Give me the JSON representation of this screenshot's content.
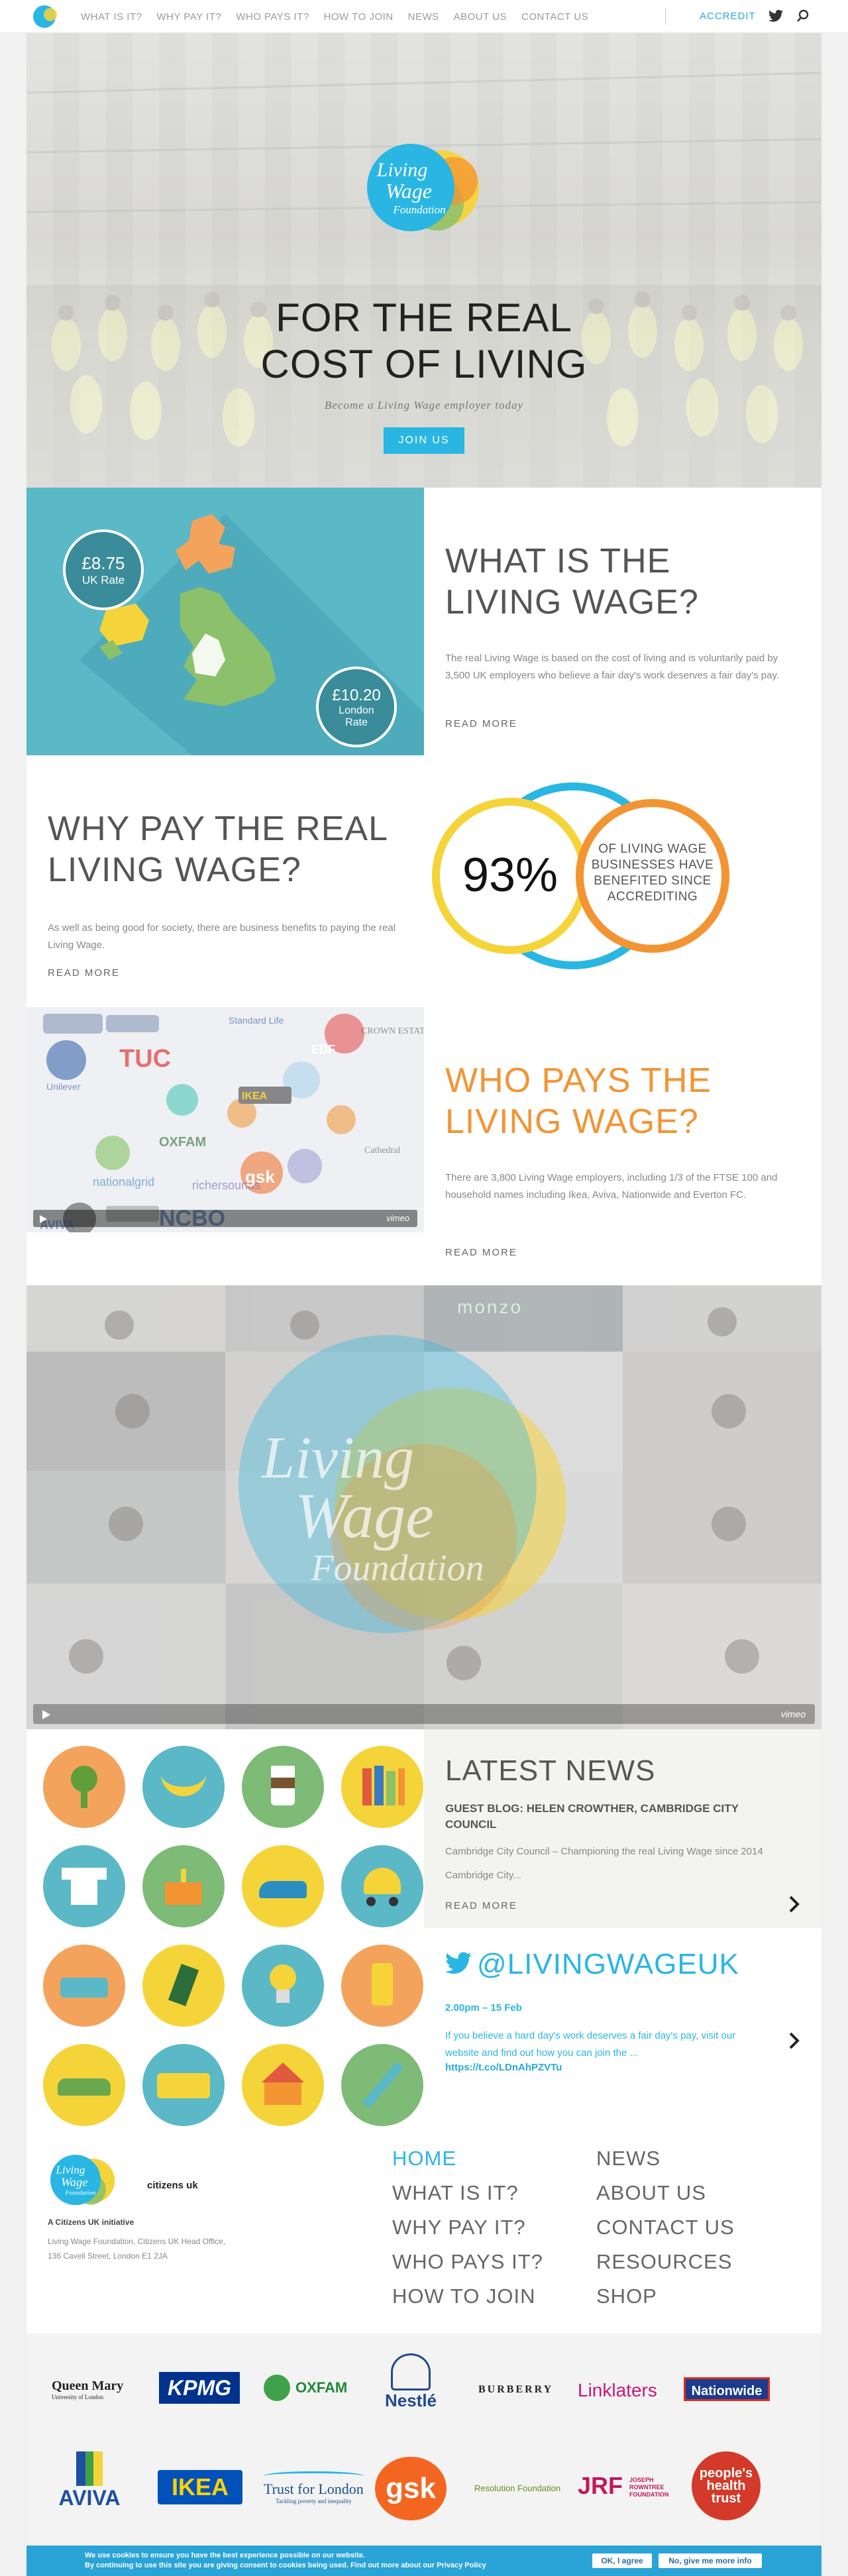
{
  "nav": {
    "items": [
      "WHAT IS IT?",
      "WHY PAY IT?",
      "WHO PAYS IT?",
      "HOW TO JOIN",
      "NEWS",
      "ABOUT US",
      "CONTACT US"
    ],
    "accredit": "ACCREDIT"
  },
  "hero": {
    "logo_line1": "Living",
    "logo_line2": "Wage",
    "logo_line3": "Foundation",
    "title_line1": "FOR THE REAL",
    "title_line2": "COST OF LIVING",
    "subtitle": "Become a Living Wage employer today",
    "button": "JOIN US"
  },
  "what": {
    "uk_rate_value": "£8.75",
    "uk_rate_label": "UK Rate",
    "london_rate_value": "£10.20",
    "london_rate_label1": "London",
    "london_rate_label2": "Rate",
    "title_line1": "WHAT IS THE",
    "title_line2": "LIVING WAGE?",
    "body": "The real Living Wage is based on the cost of living and is voluntarily paid by 3,500 UK employers who believe a fair day's work deserves a fair day's pay.",
    "read_more": "READ MORE"
  },
  "why": {
    "title_line1": "WHY PAY THE REAL",
    "title_line2": "LIVING WAGE?",
    "body": "As well as being good for society, there are business benefits to paying the real Living Wage.",
    "read_more": "READ MORE",
    "stat_value": "93%",
    "stat_line1": "OF LIVING WAGE",
    "stat_line2": "BUSINESSES HAVE",
    "stat_line3": "BENEFITED SINCE",
    "stat_line4": "ACCREDITING"
  },
  "who": {
    "title_line1": "WHO PAYS THE",
    "title_line2": "LIVING WAGE?",
    "body": "There are 3,800 Living Wage employers, including 1/3 of the FTSE 100 and household names including Ikea, Aviva, Nationwide and Everton FC.",
    "read_more": "READ MORE",
    "video_brand": "vimeo",
    "logo_labels": [
      "TUC",
      "OXFAM",
      "nationalgrid",
      "richersounds",
      "NCBO",
      "gsk",
      "Unilever",
      "Standard Life",
      "EDF",
      "IKEA",
      "CROWN ESTATE",
      "AVIVA",
      "Cathedral"
    ]
  },
  "video": {
    "logo_line1": "Living",
    "logo_line2": "Wage",
    "logo_line3": "Foundation",
    "brand": "vimeo",
    "sign_text": "monzo"
  },
  "news": {
    "heading": "LATEST NEWS",
    "post_title": "GUEST BLOG: HELEN CROWTHER, CAMBRIDGE CITY COUNCIL",
    "excerpt_line1": "Cambridge City Council – Championing the real Living Wage since 2014",
    "excerpt_line2": "Cambridge City...",
    "read_more": "READ MORE"
  },
  "twitter": {
    "handle": "@LIVINGWAGEUK",
    "time": "2.00pm – 15 Feb",
    "text": "If you believe a hard day's work deserves a fair day's pay, visit our website and find out how you can join the ...",
    "link": "https://t.co/LDnAhPZVTu"
  },
  "footer": {
    "logo_line1": "Living",
    "logo_line2": "Wage",
    "logo_line3": "Foundation",
    "citizens": "citizens uk",
    "initiative": "A Citizens UK initiative",
    "address_line1": "Living Wage Foundation, Citizens UK Head Office,",
    "address_line2": "136 Cavell Street, London E1 2JA",
    "links_left": [
      "HOME",
      "WHAT IS IT?",
      "WHY PAY IT?",
      "WHO PAYS IT?",
      "HOW TO JOIN"
    ],
    "links_right": [
      "NEWS",
      "ABOUT US",
      "CONTACT US",
      "RESOURCES",
      "SHOP"
    ]
  },
  "partners": {
    "queen_mary": "Queen Mary",
    "queen_mary_sub": "University of London",
    "kpmg": "KPMG",
    "oxfam": "OXFAM",
    "nestle": "Nestlé",
    "burberry": "BURBERRY",
    "linklaters": "Linklaters",
    "nationwide": "Nationwide",
    "aviva": "AVIVA",
    "ikea": "IKEA",
    "trust_london": "Trust for London",
    "trust_london_sub": "Tackling poverty and inequality",
    "gsk": "gsk",
    "resolution": "Resolution Foundation",
    "jrf": "JRF",
    "jrf_sub1": "JOSEPH",
    "jrf_sub2": "ROWNTREE",
    "jrf_sub3": "FOUNDATION",
    "peoples_line1": "people's",
    "peoples_line2": "health",
    "peoples_line3": "trust"
  },
  "cookie": {
    "line1": "We use cookies to ensure you have the best experience possible on our website.",
    "line2": "By continuing to use this site you are giving consent to cookies being used. Find out more about our Privacy Policy",
    "agree": "OK, I agree",
    "more": "No, give me more info"
  },
  "colors": {
    "accent_blue": "#29b6e3",
    "accent_orange": "#f39433",
    "accent_yellow": "#f5d43a",
    "accent_green": "#8cc06b"
  }
}
